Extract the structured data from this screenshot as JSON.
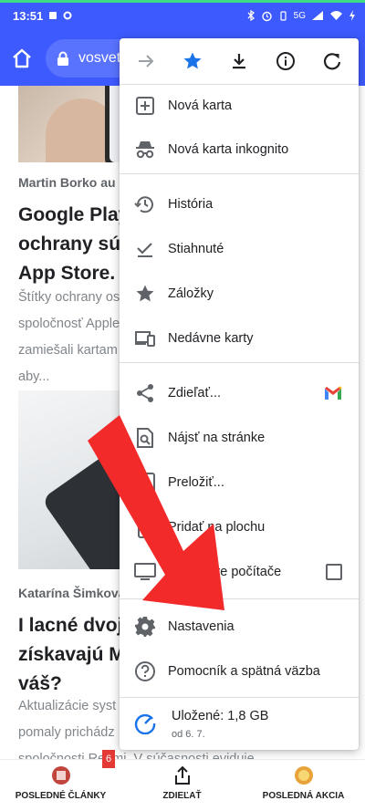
{
  "status_bar": {
    "time": "13:51",
    "network": "5G"
  },
  "address_bar": {
    "url_text": "vosvete"
  },
  "article1": {
    "author": "Martin Borko   au",
    "headline": "Google Play p\nochrany súkr\nApp Store. P",
    "excerpt": "Štítky ochrany os\nspoločnosť Apple\nzamiešali kartam\naby..."
  },
  "article2": {
    "author": "Katarína Šimková",
    "headline": "I lacné dvojro\nzískavajú MIU\nváš?",
    "excerpt": "Aktualizácie syst\npomaly prichádz\nspoločnosti Redmi. V súčasnosti eviduje"
  },
  "bottom_nav": {
    "items": [
      {
        "label": "POSLEDNÉ ČLÁNKY"
      },
      {
        "label": "ZDIEĽAŤ"
      },
      {
        "label": "POSLEDNÁ AKCIA"
      }
    ],
    "badge": "6"
  },
  "menu": {
    "toolbar": [
      "forward-icon",
      "bookmark-star-icon",
      "download-icon",
      "info-icon",
      "reload-icon"
    ],
    "items": [
      {
        "label": "Nová karta",
        "icon": "new-tab-icon"
      },
      {
        "label": "Nová karta inkognito",
        "icon": "incognito-icon"
      },
      {
        "label": "História",
        "icon": "history-icon"
      },
      {
        "label": "Stiahnuté",
        "icon": "downloads-icon"
      },
      {
        "label": "Záložky",
        "icon": "bookmarks-icon"
      },
      {
        "label": "Nedávne karty",
        "icon": "recent-tabs-icon"
      },
      {
        "label": "Zdieľať...",
        "icon": "share-icon"
      },
      {
        "label": "Nájsť na stránke",
        "icon": "find-in-page-icon"
      },
      {
        "label": "Preložiť...",
        "icon": "translate-icon"
      },
      {
        "label": "Pridať na plochu",
        "icon": "add-to-home-icon"
      },
      {
        "label": "Verzia pre počítače",
        "icon": "desktop-site-icon"
      },
      {
        "label": "Nastavenia",
        "icon": "settings-icon"
      },
      {
        "label": "Pomocník a spätná väzba",
        "icon": "help-icon"
      }
    ],
    "storage": {
      "label": "Uložené: 1,8 GB",
      "sub": "od 6. 7."
    }
  },
  "colors": {
    "brand_blue": "#3d5afe",
    "accent_star": "#1a73e8",
    "arrow_red": "#f22a2a"
  }
}
